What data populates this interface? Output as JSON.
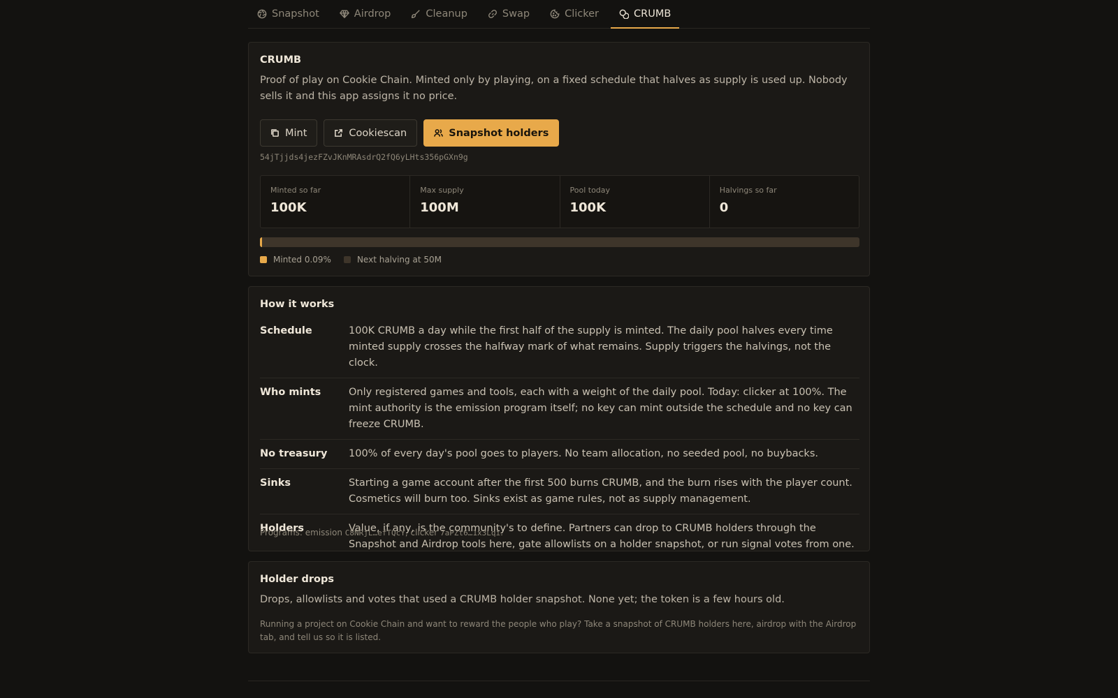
{
  "tabs": [
    {
      "label": "Snapshot",
      "icon": "aperture-icon"
    },
    {
      "label": "Airdrop",
      "icon": "gem-icon"
    },
    {
      "label": "Cleanup",
      "icon": "brush-icon"
    },
    {
      "label": "Swap",
      "icon": "link-icon"
    },
    {
      "label": "Clicker",
      "icon": "cookie-icon"
    },
    {
      "label": "CRUMB",
      "icon": "coins-icon",
      "active": true
    }
  ],
  "token": {
    "title": "CRUMB",
    "description": "Proof of play on Cookie Chain. Minted only by playing, on a fixed schedule that halves as supply is used up. Nobody sells it and this app assigns it no price.",
    "buttons": {
      "mint": "Mint",
      "cookiescan": "Cookiescan",
      "snapshot": "Snapshot holders"
    },
    "mint_address": "54jTjjds4jezFZvJKnMRAsdrQ2fQ6yLHts356pGXn9g",
    "stats": [
      {
        "label": "Minted so far",
        "value": "100K"
      },
      {
        "label": "Max supply",
        "value": "100M"
      },
      {
        "label": "Pool today",
        "value": "100K"
      },
      {
        "label": "Halvings so far",
        "value": "0"
      }
    ],
    "progress_percent": 0.09,
    "legend": {
      "minted": "Minted 0.09%",
      "next": "Next halving at 50M"
    }
  },
  "how": {
    "title": "How it works",
    "rows": [
      {
        "key": "Schedule",
        "value": "100K CRUMB a day while the first half of the supply is minted. The daily pool halves every time minted supply crosses the halfway mark of what remains. Supply triggers the halvings, not the clock."
      },
      {
        "key": "Who mints",
        "value": "Only registered games and tools, each with a weight of the daily pool. Today: clicker at 100%. The mint authority is the emission program itself; no key can mint outside the schedule and no key can freeze CRUMB."
      },
      {
        "key": "No treasury",
        "value": "100% of every day's pool goes to players. No team allocation, no seeded pool, no buybacks."
      },
      {
        "key": "Sinks",
        "value": "Starting a game account after the first 500 burns CRUMB, and the burn rises with the player count. Cosmetics will burn too. Sinks exist as game rules, not as supply management."
      },
      {
        "key": "Holders",
        "value": "Value, if any, is the community's to define. Partners can drop to CRUMB holders through the Snapshot and Airdrop tools here, gate allowlists on a holder snapshot, or run signal votes from one."
      }
    ],
    "programs_prefix": "Programs: emission ",
    "emission_program": "C8NRjL…efTQcY",
    "programs_mid": ", clicker ",
    "clicker_program": "7aPZt6…1x3Lqi",
    "programs_suffix": "."
  },
  "drops": {
    "title": "Holder drops",
    "text": "Drops, allowlists and votes that used a CRUMB holder snapshot. None yet; the token is a few hours old.",
    "note": "Running a project on Cookie Chain and want to reward the people who play? Take a snapshot of CRUMB holders here, airdrop with the Airdrop tab, and tell us so it is listed."
  },
  "colors": {
    "accent": "#e8a94a",
    "track": "#3e352a"
  }
}
